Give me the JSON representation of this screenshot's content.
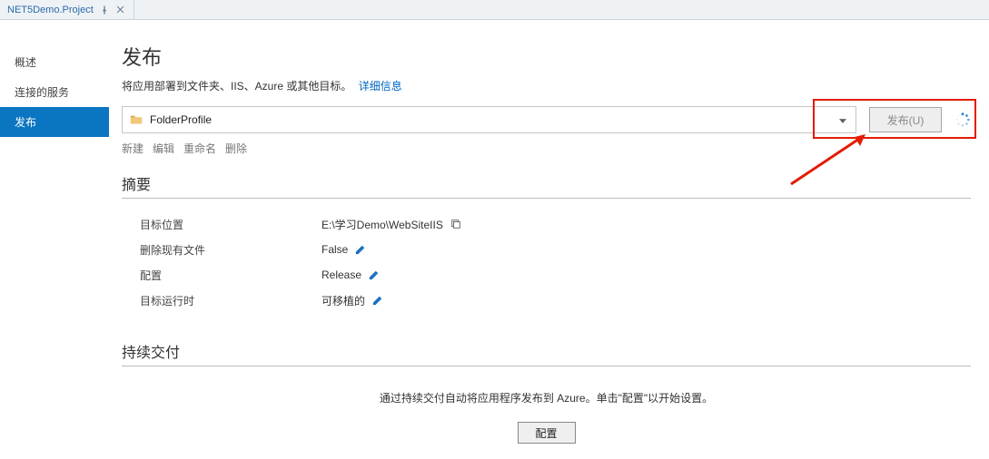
{
  "tab": {
    "title": "NET5Demo.Project"
  },
  "sidebar": {
    "items": [
      {
        "label": "概述"
      },
      {
        "label": "连接的服务"
      },
      {
        "label": "发布"
      }
    ],
    "activeIndex": 2
  },
  "publish": {
    "title": "发布",
    "description": "将应用部署到文件夹、IIS、Azure 或其他目标。",
    "detailsLink": "详细信息",
    "profileName": "FolderProfile",
    "buttonLabel": "发布(U)",
    "actions": {
      "new": "新建",
      "edit": "编辑",
      "rename": "重命名",
      "delete": "删除"
    }
  },
  "summary": {
    "title": "摘要",
    "rows": [
      {
        "label": "目标位置",
        "value": "E:\\学习Demo\\WebSiteIIS",
        "icon": "copy"
      },
      {
        "label": "删除现有文件",
        "value": "False",
        "icon": "edit"
      },
      {
        "label": "配置",
        "value": "Release",
        "icon": "edit"
      },
      {
        "label": "目标运行时",
        "value": "可移植的",
        "icon": "edit"
      }
    ]
  },
  "cd": {
    "title": "持续交付",
    "description": "通过持续交付自动将应用程序发布到 Azure。单击\"配置\"以开始设置。",
    "buttonLabel": "配置"
  }
}
